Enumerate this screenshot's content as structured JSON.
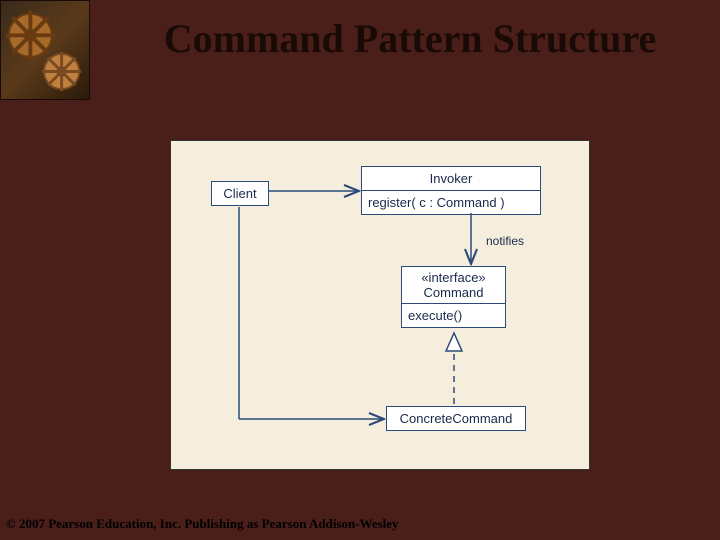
{
  "title": "Command Pattern Structure",
  "footer": "© 2007 Pearson Education, Inc. Publishing as Pearson Addison-Wesley",
  "client": {
    "name": "Client"
  },
  "invoker": {
    "name": "Invoker",
    "method": "register( c : Command )"
  },
  "command": {
    "stereotype": "«interface»",
    "name": "Command",
    "method": "execute()"
  },
  "concrete": {
    "name": "ConcreteCommand"
  },
  "relations": {
    "notifies": "notifies"
  }
}
